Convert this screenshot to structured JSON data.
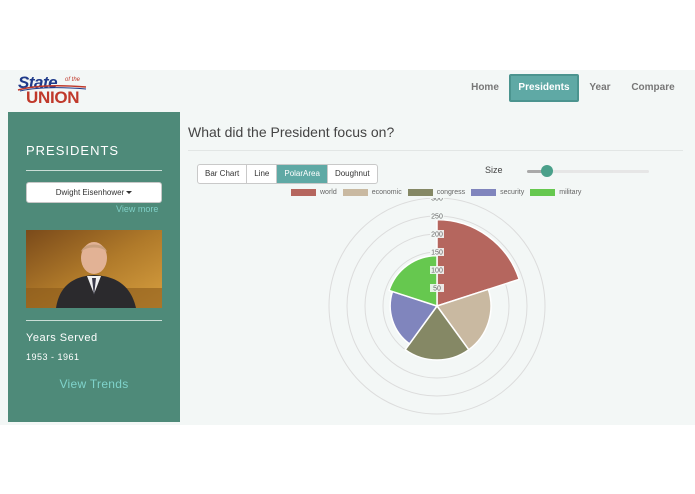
{
  "brand": {
    "logo_top": "State",
    "logo_small": "of the",
    "logo_bottom": "UNION"
  },
  "nav": [
    {
      "label": "Home",
      "active": false
    },
    {
      "label": "Presidents",
      "active": true
    },
    {
      "label": "Year",
      "active": false
    },
    {
      "label": "Compare",
      "active": false
    }
  ],
  "sidebar": {
    "title": "PRESIDENTS",
    "selected_president": "Dwight Eisenhower",
    "view_more": "View more",
    "years_label": "Years Served",
    "years_value": "1953 - 1961",
    "trends_link": "View Trends"
  },
  "main": {
    "title": "What did the President focus on?",
    "chart_types": [
      {
        "label": "Bar Chart",
        "active": false
      },
      {
        "label": "Line",
        "active": false
      },
      {
        "label": "PolarArea",
        "active": true
      },
      {
        "label": "Doughnut",
        "active": false
      }
    ],
    "size_label": "Size",
    "size_level": 0.15
  },
  "colors": {
    "accent": "#5fa9a5",
    "sidebar": "#4e8a79",
    "link": "#7fcfc6"
  },
  "chart_data": {
    "type": "polarArea",
    "categories": [
      "world",
      "economic",
      "congress",
      "security",
      "military"
    ],
    "values": [
      240,
      150,
      150,
      130,
      140
    ],
    "colors": [
      "#b5665e",
      "#c9b9a1",
      "#858865",
      "#8085bd",
      "#66c84f"
    ],
    "rlim": [
      0,
      300
    ],
    "ticks": [
      "50",
      "100",
      "150",
      "200",
      "250",
      "300"
    ],
    "legend": "top"
  }
}
